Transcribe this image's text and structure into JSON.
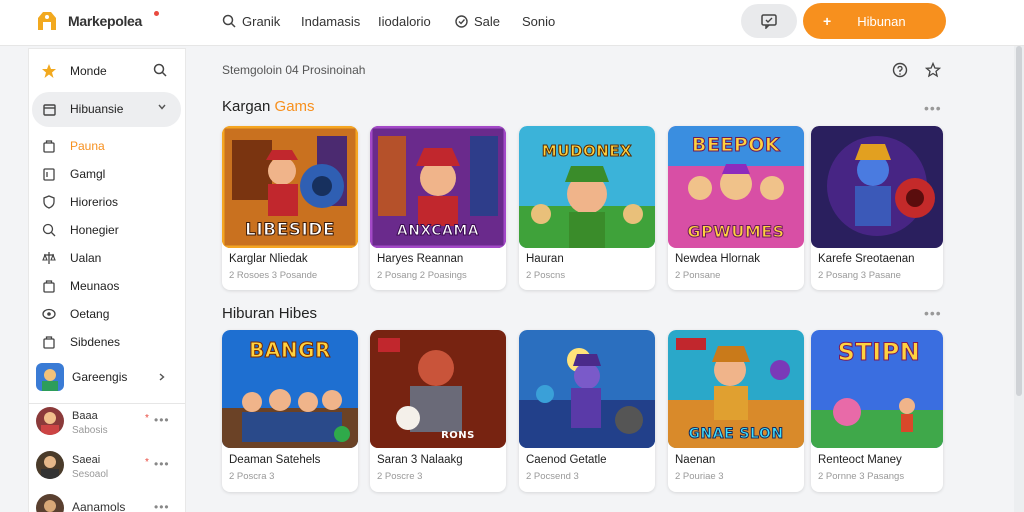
{
  "app": {
    "brand": "Markepolea"
  },
  "topnav": {
    "items": [
      {
        "label": "Granik",
        "icon": "search-icon"
      },
      {
        "label": "Indamasis",
        "icon": ""
      },
      {
        "label": "Iiodalorio",
        "icon": ""
      },
      {
        "label": "Sale",
        "icon": "tag-icon"
      },
      {
        "label": "Sonio",
        "icon": ""
      }
    ],
    "cta_label": "Hibunan",
    "messages_icon": "chat-icon"
  },
  "sidebar": {
    "home_label": "Monde",
    "active_label": "Hibuansie",
    "items": [
      {
        "label": "Pauna",
        "icon": "bag-icon",
        "highlight": true
      },
      {
        "label": "Gamgl",
        "icon": "box-icon"
      },
      {
        "label": "Hiorerios",
        "icon": "shield-icon"
      },
      {
        "label": "Honegier",
        "icon": "search-icon"
      },
      {
        "label": "Ualan",
        "icon": "scale-icon"
      },
      {
        "label": "Meunaos",
        "icon": "bag-icon"
      },
      {
        "label": "Oetang",
        "icon": "eye-icon"
      },
      {
        "label": "Sibdenes",
        "icon": "bag-icon"
      }
    ],
    "group_label": "Gareengis",
    "subscriptions": [
      {
        "name": "Baaa",
        "meta": "Sabosis",
        "dot": "*"
      },
      {
        "name": "Saeai",
        "meta": "Sesoaol",
        "dot": "*"
      },
      {
        "name": "Aanamols",
        "meta": "",
        "dot": ""
      }
    ]
  },
  "main": {
    "header_text": "Stemgoloin 04 Prosinoinah",
    "sections": [
      {
        "title_a": "Kargan",
        "title_b": "Gams",
        "cards": [
          {
            "title": "Karglar Nliedak",
            "meta": "2 Rosoes 3 Posande",
            "art": "LIBESIDE"
          },
          {
            "title": "Haryes Reannan",
            "meta": "2 Posang 2 Poasings",
            "art": "ANXCAMA"
          },
          {
            "title": "Hauran",
            "meta": "2 Poscns",
            "art": "MUDONEX"
          },
          {
            "title": "Newdea Hlornak",
            "meta": "2 Ponsane",
            "art": "GPWUMES"
          },
          {
            "title": "Karefe Sreotaenan",
            "meta": "2 Posang 3 Pasane",
            "art": ""
          }
        ]
      },
      {
        "title_a": "Hiburan Hibes",
        "title_b": "",
        "cards": [
          {
            "title": "Deaman Satehels",
            "meta": "2 Poscra 3",
            "art": "BANGR"
          },
          {
            "title": "Saran 3 Nalaakg",
            "meta": "2 Poscre 3",
            "art": "RONS"
          },
          {
            "title": "Caenod Getatle",
            "meta": "2 Pocsend 3",
            "art": ""
          },
          {
            "title": "Naenan",
            "meta": "2 Pouriae 3",
            "art": "GNAE SLON"
          },
          {
            "title": "Renteoct Maney",
            "meta": "2 Pornne 3 Pasangs",
            "art": "STIPN"
          }
        ]
      }
    ]
  },
  "colors": {
    "accent": "#f7901e",
    "logo": "#f2a91f",
    "badge": "#e94a3f"
  }
}
